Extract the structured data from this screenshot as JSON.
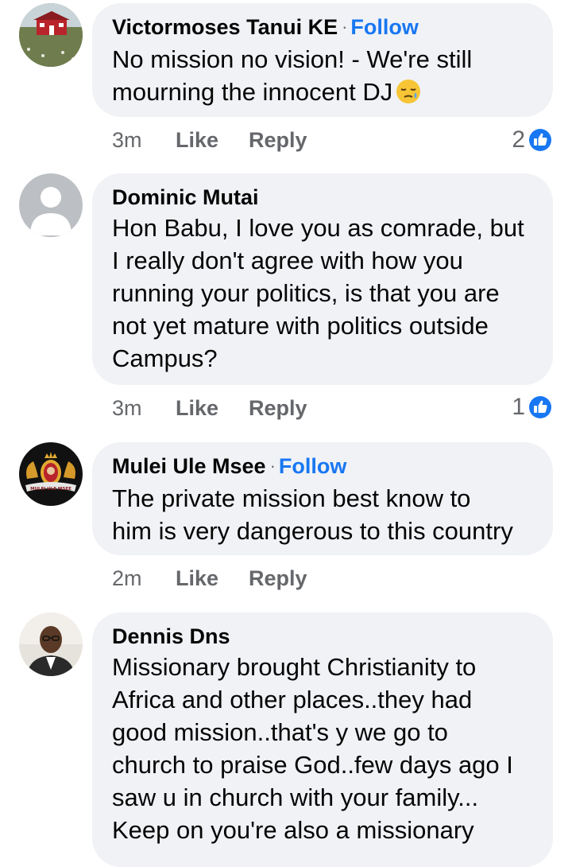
{
  "comments": [
    {
      "author": "Victormoses Tanui KE",
      "separator": "·",
      "follow_label": "Follow",
      "lines": [
        "No mission no vision! - We're still",
        "mourning the innocent DJ"
      ],
      "emoji": "sleepy-face-emoji",
      "time": "3m",
      "like_label": "Like",
      "reply_label": "Reply",
      "reaction_count": "2",
      "reaction_icon": "like-reaction-icon"
    },
    {
      "author": "Dominic Mutai",
      "lines": [
        "Hon Babu, I love you as comrade, but",
        "I really don't agree with how you",
        "running your politics, is that you are",
        "not yet mature with politics outside",
        "Campus?"
      ],
      "time": "3m",
      "like_label": "Like",
      "reply_label": "Reply",
      "reaction_count": "1",
      "reaction_icon": "like-reaction-icon"
    },
    {
      "author": "Mulei Ule Msee",
      "separator": "·",
      "follow_label": "Follow",
      "lines": [
        "The private mission best know to",
        "him is very dangerous to this country"
      ],
      "avatar_text": "MULEI ULE MSEE",
      "time": "2m",
      "like_label": "Like",
      "reply_label": "Reply"
    },
    {
      "author": "Dennis Dns",
      "lines": [
        "Missionary brought Christianity to",
        "Africa and other places..they had",
        "good mission..that's y we go to",
        "church to praise God..few days ago I",
        "saw u in church with your family...",
        "Keep on you're also a missionary"
      ]
    }
  ],
  "colors": {
    "bubble": "#f0f2f5",
    "link": "#1877f2",
    "secondary_text": "#65676b"
  }
}
